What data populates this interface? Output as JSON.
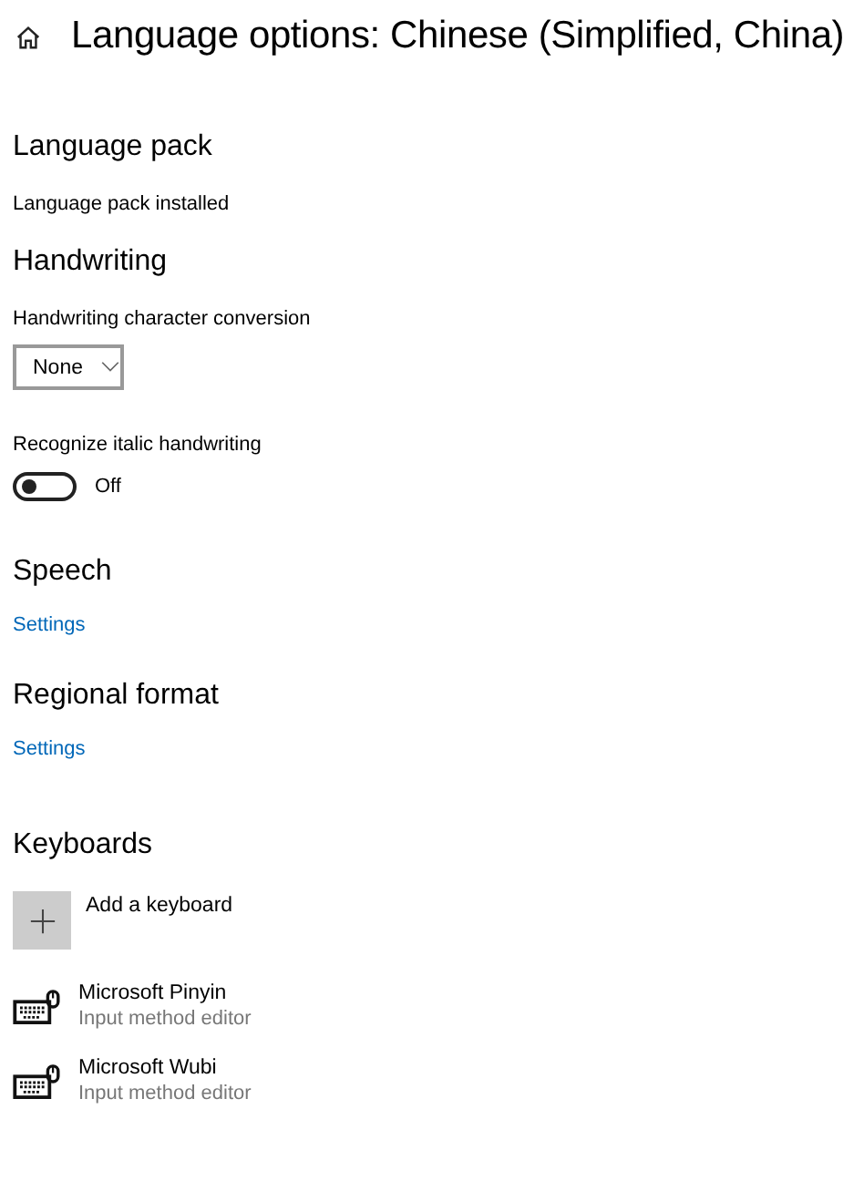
{
  "title": "Language options: Chinese (Simplified, China)",
  "language_pack": {
    "heading": "Language pack",
    "status": "Language pack installed"
  },
  "handwriting": {
    "heading": "Handwriting",
    "conversion_label": "Handwriting character conversion",
    "conversion_value": "None",
    "italic_label": "Recognize italic handwriting",
    "italic_on": false,
    "italic_state": "Off"
  },
  "speech": {
    "heading": "Speech",
    "link": "Settings"
  },
  "regional_format": {
    "heading": "Regional format",
    "link": "Settings"
  },
  "keyboards": {
    "heading": "Keyboards",
    "add_label": "Add a keyboard",
    "items": [
      {
        "name": "Microsoft Pinyin",
        "description": "Input method editor"
      },
      {
        "name": "Microsoft Wubi",
        "description": "Input method editor"
      }
    ]
  }
}
